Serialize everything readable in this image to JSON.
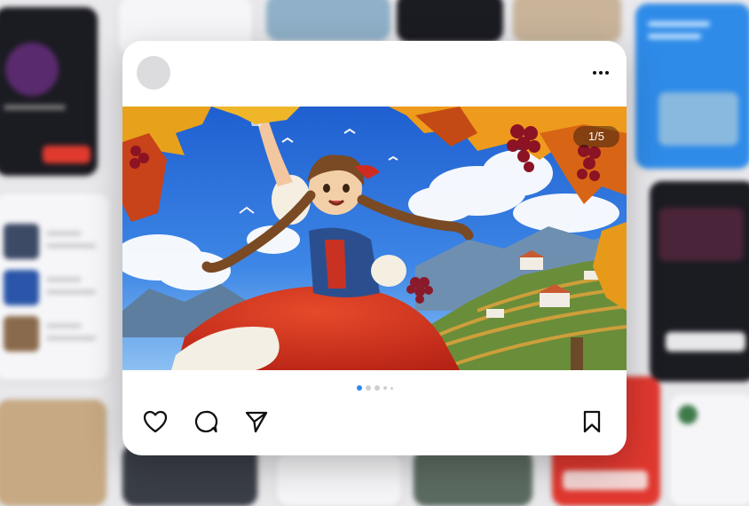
{
  "post": {
    "media_counter": "1/5",
    "carousel": {
      "total": 5,
      "active_index": 0
    },
    "icons": {
      "more": "more-horizontal-icon",
      "like": "heart-icon",
      "comment": "comment-bubble-icon",
      "share": "send-icon",
      "save": "bookmark-icon"
    }
  },
  "colors": {
    "accent": "#2d88f0",
    "icon": "#111111",
    "card": "#ffffff"
  }
}
